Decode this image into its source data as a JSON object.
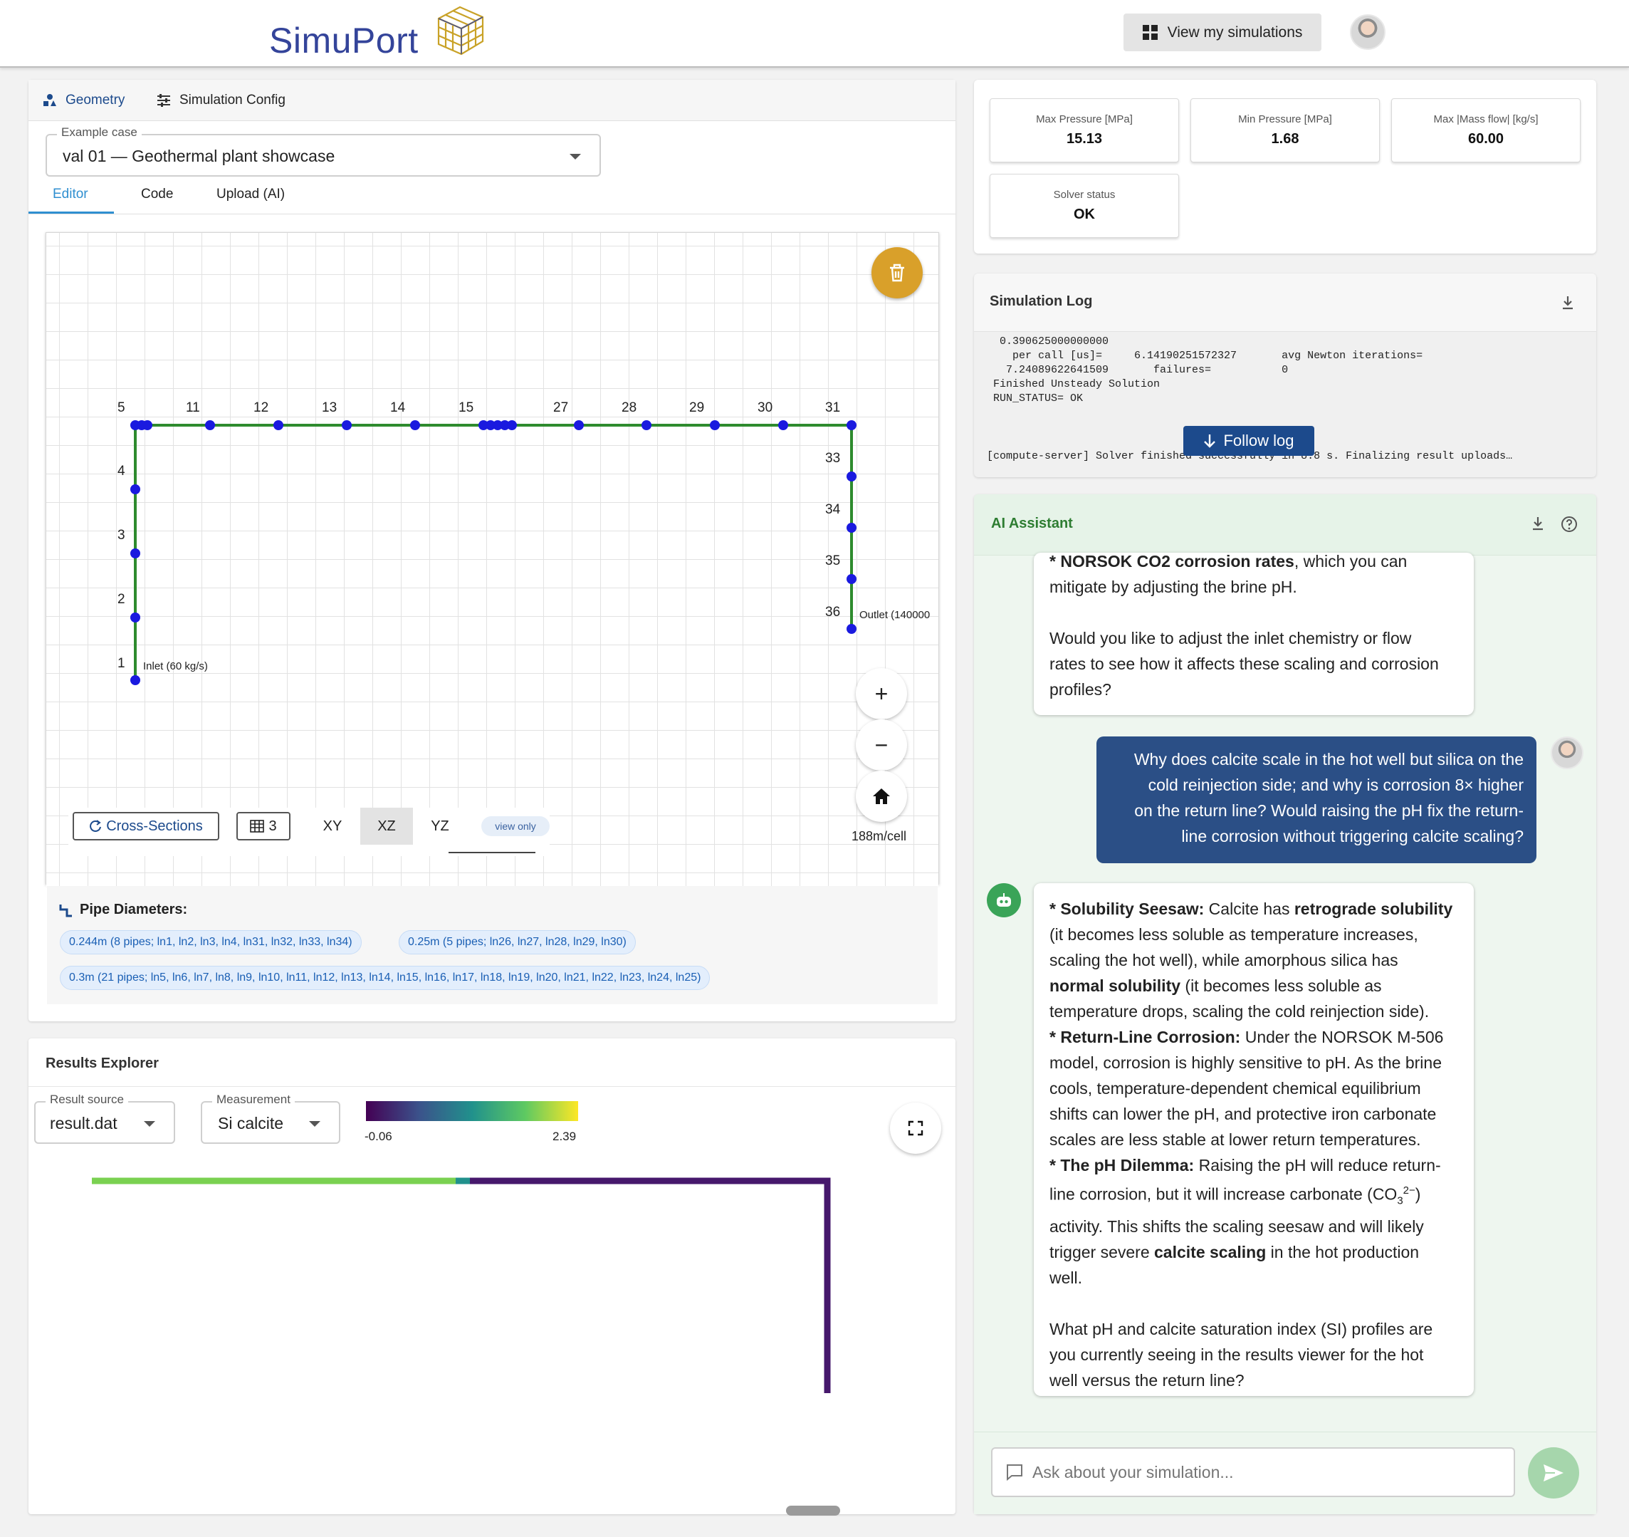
{
  "header": {
    "logo_text": "SimuPort",
    "view_sims_label": "View my simulations"
  },
  "left": {
    "tabs": [
      {
        "label": "Geometry",
        "icon": "shapes-icon",
        "active": true
      },
      {
        "label": "Simulation Config",
        "icon": "sliders-icon",
        "active": false
      }
    ],
    "example_case": {
      "label": "Example case",
      "value": "val 01 — Geothermal plant showcase"
    },
    "sub_tabs": [
      {
        "label": "Editor",
        "active": true
      },
      {
        "label": "Code",
        "active": false
      },
      {
        "label": "Upload (AI)",
        "active": false
      }
    ],
    "network": {
      "top_labels": [
        "5",
        "11",
        "12",
        "13",
        "14",
        "15",
        "27",
        "28",
        "29",
        "30",
        "31"
      ],
      "left_labels": [
        "4",
        "3",
        "2",
        "1"
      ],
      "right_labels": [
        "33",
        "34",
        "35",
        "36"
      ],
      "inlet_label": "Inlet (60 kg/s)",
      "outlet_label": "Outlet (140000"
    },
    "toolbar": {
      "cross_sections": "Cross-Sections",
      "grid_count": "3",
      "views": [
        "XY",
        "XZ",
        "YZ"
      ],
      "active_view": "XZ",
      "view_only": "view only",
      "cell_size": "188m/cell"
    },
    "diameters": {
      "title": "Pipe Diameters:",
      "chips": [
        "0.244m (8 pipes; ln1, ln2, ln3, ln4, ln31, ln32, ln33, ln34)",
        "0.25m (5 pipes; ln26, ln27, ln28, ln29, ln30)",
        "0.3m (21 pipes; ln5, ln6, ln7, ln8, ln9, ln10, ln11, ln12, ln13, ln14, ln15, ln16, ln17, ln18, ln19, ln20, ln21, ln22, ln23, ln24, ln25)"
      ]
    }
  },
  "results": {
    "title": "Results Explorer",
    "result_source": {
      "label": "Result source",
      "value": "result.dat"
    },
    "measurement": {
      "label": "Measurement",
      "value": "Si calcite"
    },
    "colorbar": {
      "min": "-0.06",
      "max": "2.39",
      "colormap": "viridis"
    }
  },
  "metrics": [
    {
      "label": "Max Pressure [MPa]",
      "value": "15.13"
    },
    {
      "label": "Min Pressure [MPa]",
      "value": "1.68"
    },
    {
      "label": "Max |Mass flow| [kg/s]",
      "value": "60.00"
    },
    {
      "label": "Solver status",
      "value": "OK"
    }
  ],
  "log": {
    "title": "Simulation Log",
    "lines": [
      "  0.390625000000000",
      "    per call [us]=     6.14190251572327       avg Newton iterations=",
      "   7.24089622641509       failures=           0",
      " Finished Unsteady Solution",
      " RUN_STATUS= OK"
    ],
    "last_line": "[compute-server] Solver finished successfully in 8.8 s. Finalizing result uploads…",
    "follow_label": "Follow log"
  },
  "assistant": {
    "title": "AI Assistant",
    "prev_msg": {
      "l1_bold": "* NORSOK CO2 corrosion rates",
      "l1_rest": ", which you can",
      "l2": "mitigate by adjusting the brine pH.",
      "l3": "Would you like to adjust the inlet chemistry or flow",
      "l4": "rates to see how it affects these scaling and corrosion",
      "l5": "profiles?"
    },
    "user_msg": [
      "Why does calcite scale in the hot well but silica on the",
      "cold reinjection side; and why is corrosion 8× higher",
      "on the return line? Would raising the pH fix the return-",
      "line corrosion without triggering calcite scaling?"
    ],
    "reply": {
      "s1_bold": "* Solubility Seesaw:",
      "s1_a": " Calcite has ",
      "s1_b_bold": "retrograde solubility",
      "s1_c": "(it becomes less soluble as temperature increases,",
      "s1_d": "scaling the hot well), while amorphous silica has",
      "s1_e_bold": "normal solubility",
      "s1_f": " (it becomes less soluble as",
      "s1_g": "temperature drops, scaling the cold reinjection side).",
      "s2_bold": "* Return-Line Corrosion:",
      "s2_a": " Under the NORSOK M-506",
      "s2_b": "model, corrosion is highly sensitive to pH. As the brine",
      "s2_c": "cools, temperature-dependent chemical equilibrium",
      "s2_d": "shifts can lower the pH, and protective iron carbonate",
      "s2_e": "scales are less stable at lower return temperatures.",
      "s3_bold": "* The pH Dilemma:",
      "s3_a": " Raising the pH will reduce return-",
      "s3_b1": "line corrosion, but it will increase carbonate (CO",
      "s3_sub": "3",
      "s3_sup": "2−",
      "s3_b2": ")",
      "s3_c": "activity. This shifts the scaling seesaw and will likely",
      "s3_d1": "trigger severe ",
      "s3_d_bold": "calcite scaling",
      "s3_d2": " in the hot production",
      "s3_e": "well.",
      "q1": "What pH and calcite saturation index (SI) profiles are",
      "q2": "you currently seeing in the results viewer for the hot",
      "q3": "well versus the return line?"
    },
    "input_placeholder": "Ask about your simulation..."
  }
}
